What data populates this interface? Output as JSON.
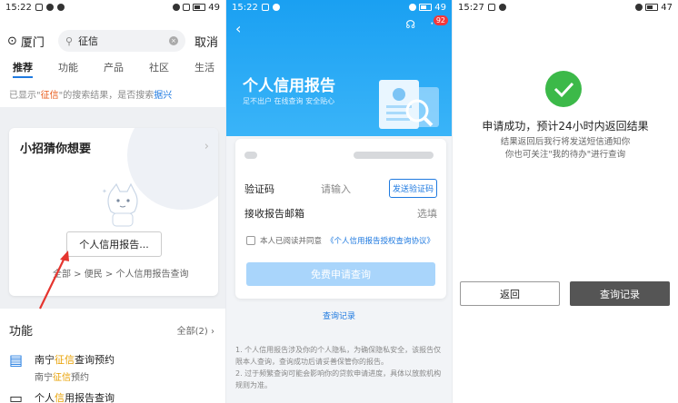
{
  "p1": {
    "status": {
      "time": "15:22",
      "battery": "49"
    },
    "city": "厦门",
    "search_value": "征信",
    "cancel": "取消",
    "tabs": [
      "推荐",
      "功能",
      "产品",
      "社区",
      "生活"
    ],
    "hint": {
      "pre": "已显示\"",
      "kw": "征信",
      "mid": "\"的搜索结果，是否搜索",
      "link": "据兴"
    },
    "card": {
      "title": "小招猜你想要",
      "button": "个人信用报告...",
      "path": "全部 > 便民 > 个人信用报告查询"
    },
    "func": {
      "title": "功能",
      "all": "全部(2)"
    },
    "items": [
      {
        "t_pre": "南宁",
        "t_kw": "征信",
        "t_post": "查询预约",
        "s_pre": "南宁",
        "s_kw": "征信",
        "s_post": "预约"
      },
      {
        "t_pre": "个人",
        "t_kw": "信",
        "t_post": "用报告查询"
      }
    ]
  },
  "p2": {
    "status": {
      "time": "15:22",
      "battery": "49"
    },
    "badge": "92",
    "title": "个人信用报告",
    "subtitle": "足不出户 在线查询 安全贴心",
    "code_label": "验证码",
    "code_placeholder": "请输入",
    "send_btn": "发送验证码",
    "email_label": "接收报告邮箱",
    "email_value": "选填",
    "agree_pre": "本人已阅读并同意",
    "agree_link": "《个人信用报告授权查询协议》",
    "submit": "免费申请查询",
    "record": "查询记录",
    "note1": "1. 个人信用报告涉及你的个人隐私，为确保隐私安全，该报告仅限本人查询，查询成功后请妥善保管你的报告。",
    "note2": "2. 过于频繁查询可能会影响你的贷款申请进度，具体以放款机构规则为准。"
  },
  "p3": {
    "status": {
      "time": "15:27",
      "battery": "47"
    },
    "title": "申请成功，预计24小时内返回结果",
    "line1": "结果返回后我行将发送短信通知你",
    "line2": "你也可关注\"我的待办\"进行查询",
    "back": "返回",
    "query": "查询记录"
  },
  "colors": {
    "accent": "#1f7ae0",
    "success": "#3cb949",
    "keyword": "#e85a19"
  }
}
